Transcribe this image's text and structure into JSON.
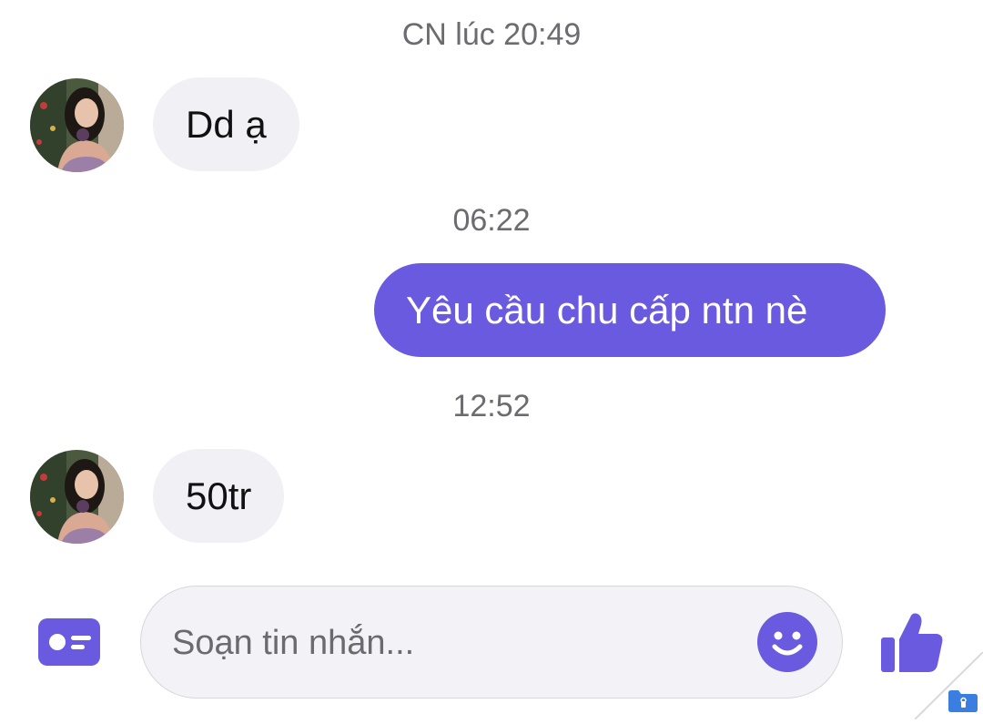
{
  "conversation": {
    "messages": [
      {
        "timestamp": "CN lúc 20:49",
        "direction": "incoming",
        "text": "Dd ạ",
        "has_avatar": true
      },
      {
        "timestamp": "06:22",
        "direction": "outgoing",
        "text": "Yêu cầu chu cấp ntn nè",
        "has_avatar": false
      },
      {
        "timestamp": "12:52",
        "direction": "incoming",
        "text": "50tr",
        "has_avatar": true
      }
    ]
  },
  "composer": {
    "placeholder": "Soạn tin nhắn...",
    "left_icon": "contact-card-icon",
    "emoji_icon": "smiley-icon",
    "send_icon": "thumbs-up-icon"
  },
  "colors": {
    "outgoing_bubble": "#6a5ae0",
    "incoming_bubble": "#f0f0f5",
    "accent": "#6a5ae0",
    "timestamp_text": "#6b6b70"
  }
}
